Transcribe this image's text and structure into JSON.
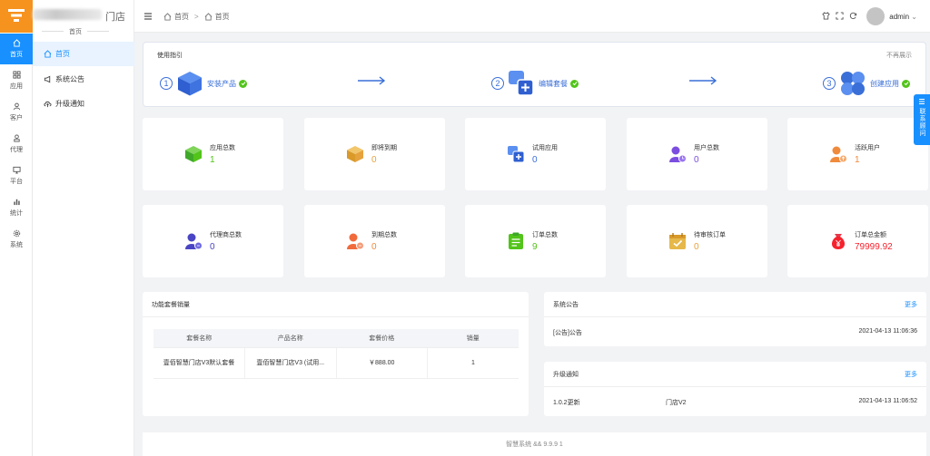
{
  "brand": {
    "name": "门店",
    "subtitle": "首页"
  },
  "rail": [
    {
      "label": "首页",
      "icon": "home-icon"
    },
    {
      "label": "应用",
      "icon": "grid-icon"
    },
    {
      "label": "客户",
      "icon": "user-icon"
    },
    {
      "label": "代理",
      "icon": "agent-icon"
    },
    {
      "label": "平台",
      "icon": "monitor-icon"
    },
    {
      "label": "统计",
      "icon": "bar-chart-icon"
    },
    {
      "label": "系统",
      "icon": "gear-icon"
    }
  ],
  "sidebar": [
    {
      "label": "首页",
      "icon": "home-icon"
    },
    {
      "label": "系统公告",
      "icon": "megaphone-icon"
    },
    {
      "label": "升级通知",
      "icon": "cloud-upload-icon"
    }
  ],
  "header": {
    "breadcrumb": [
      "首页",
      "首页"
    ],
    "separator": ">",
    "username": "admin"
  },
  "guide": {
    "title": "使用指引",
    "dismiss": "不再展示",
    "steps": [
      {
        "num": "1",
        "label": "安装产品"
      },
      {
        "num": "2",
        "label": "编辑套餐"
      },
      {
        "num": "3",
        "label": "创建应用"
      }
    ]
  },
  "stats": [
    {
      "label": "应用总数",
      "value": "1",
      "color": "#52c41a"
    },
    {
      "label": "即将到期",
      "value": "0",
      "color": "#e6a23c"
    },
    {
      "label": "试用应用",
      "value": "0",
      "color": "#3a6fd8"
    },
    {
      "label": "用户总数",
      "value": "0",
      "color": "#7b4ee0"
    },
    {
      "label": "活跃用户",
      "value": "1",
      "color": "#f08a3c"
    },
    {
      "label": "代理商总数",
      "value": "0",
      "color": "#4a45c4"
    },
    {
      "label": "到期总数",
      "value": "0",
      "color": "#f08a3c"
    },
    {
      "label": "订单总数",
      "value": "9",
      "color": "#52c41a"
    },
    {
      "label": "待审核订单",
      "value": "0",
      "color": "#e6a23c"
    },
    {
      "label": "订单总金额",
      "value": "79999.92",
      "color": "#f5222d"
    }
  ],
  "sales": {
    "title": "功能套餐销量",
    "columns": [
      "套餐名称",
      "产品名称",
      "套餐价格",
      "销量"
    ],
    "rows": [
      [
        "壹佰智慧门店V3默认套餐",
        "壹佰智慧门店V3 (试用...",
        "￥888.00",
        "1"
      ]
    ]
  },
  "notice": {
    "title": "系统公告",
    "more": "更多",
    "items": [
      {
        "text": "[公告]公告",
        "time": "2021-04-13 11:06:36"
      }
    ]
  },
  "upgrade": {
    "title": "升级通知",
    "more": "更多",
    "items": [
      {
        "version": "1.0.2更新",
        "product": "门店V2",
        "time": "2021-04-13 11:06:52"
      }
    ]
  },
  "footer": "智慧系统 && 9.9.9   1",
  "contact": {
    "label": "联系顾问"
  }
}
